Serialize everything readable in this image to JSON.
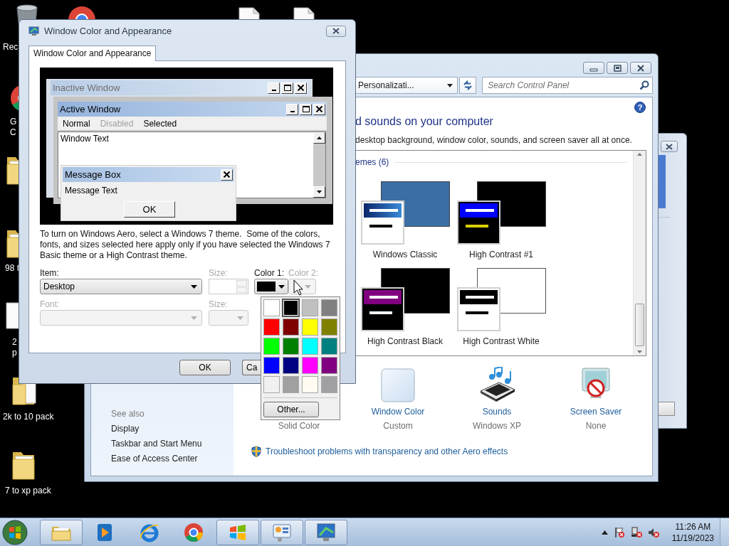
{
  "desktop": {
    "icons": [
      {
        "kind": "recycle-bin",
        "label_lines": [
          "Rec"
        ]
      },
      {
        "kind": "round-logo"
      },
      {
        "kind": "document"
      },
      {
        "kind": "document"
      },
      {
        "kind": "round-logo",
        "label_lines": [
          "G",
          "C"
        ]
      },
      {
        "kind": "folder"
      },
      {
        "kind": "folder",
        "label_lines": [
          "98 t"
        ]
      },
      {
        "kind": "document",
        "label_lines": [
          "2",
          "p"
        ]
      },
      {
        "kind": "folder-page",
        "label_lines": [
          "2k to 10 pack"
        ]
      },
      {
        "kind": "folder",
        "label_lines": [
          "7 to xp pack"
        ]
      }
    ]
  },
  "control_panel": {
    "address": "Personalizati...",
    "help_button": "?",
    "search": {
      "placeholder": "Search Control Panel"
    },
    "heading": "d sounds on your computer",
    "subtitle": "desktop background, window color, sounds, and screen saver all at once.",
    "themes_header": "emes (6)",
    "themes": [
      {
        "name": "Windows Classic",
        "kind": "classic"
      },
      {
        "name": "High Contrast #1",
        "kind": "contrast-1"
      },
      {
        "name": "High Contrast Black",
        "kind": "contrast-black"
      },
      {
        "name": "High Contrast White",
        "kind": "contrast-white"
      }
    ],
    "settings": [
      {
        "kind": "background",
        "value": "Solid Color"
      },
      {
        "kind": "window-color",
        "title": "Window Color",
        "value": "Custom"
      },
      {
        "kind": "sounds",
        "title": "Sounds",
        "value": "Windows XP"
      },
      {
        "kind": "screen-saver",
        "title": "Screen Saver",
        "value": "None"
      }
    ],
    "see_also": {
      "title": "See also",
      "links": [
        "Display",
        "Taskbar and Start Menu",
        "Ease of Access Center"
      ]
    },
    "troubleshoot_link": "Troubleshoot problems with transparency and other Aero effects"
  },
  "appearance_dialog": {
    "title": "Window Color and Appearance",
    "tabs": [
      {
        "label": "Window Color and Appearance",
        "selected": true
      }
    ],
    "preview": {
      "inactive_title": "Inactive Window",
      "active_title": "Active Window",
      "menu": [
        {
          "label": "Normal",
          "disabled": false
        },
        {
          "label": "Disabled",
          "disabled": true
        },
        {
          "label": "Selected",
          "disabled": false
        }
      ],
      "window_text": "Window Text",
      "message_title": "Message Box",
      "message_text": "Message Text",
      "message_button": "OK"
    },
    "note": "To turn on Windows Aero, select a Windows 7 theme.  Some of the colors, fonts, and sizes selected here apply only if you have selected the Windows 7 Basic theme or a High Contrast theme.",
    "item": {
      "label": "Item:",
      "value": "Desktop",
      "disabled": false
    },
    "size": {
      "label": "Size:",
      "disabled": true
    },
    "color_1": {
      "label": "Color 1:",
      "color": "#000000",
      "disabled": false
    },
    "color_2": {
      "label": "Color 2:",
      "disabled": true
    },
    "font": {
      "label": "Font:",
      "disabled": true
    },
    "font_size": {
      "label": "Size:",
      "disabled": true
    },
    "buttons": [
      "OK",
      "Ca"
    ]
  },
  "color_picker": {
    "swatches": [
      {
        "color": "#ffffff",
        "selected": false
      },
      {
        "color": "#000000",
        "selected": true
      },
      {
        "color": "#c0c0c0",
        "selected": false
      },
      {
        "color": "#808080",
        "selected": false
      },
      {
        "color": "#ff0000",
        "selected": false
      },
      {
        "color": "#800000",
        "selected": false
      },
      {
        "color": "#ffff00",
        "selected": false
      },
      {
        "color": "#808000",
        "selected": false
      },
      {
        "color": "#00ff00",
        "selected": false
      },
      {
        "color": "#008000",
        "selected": false
      },
      {
        "color": "#00ffff",
        "selected": false
      },
      {
        "color": "#008080",
        "selected": false
      },
      {
        "color": "#0000ff",
        "selected": false
      },
      {
        "color": "#000080",
        "selected": false
      },
      {
        "color": "#ff00ff",
        "selected": false
      },
      {
        "color": "#800080",
        "selected": false
      },
      {
        "color": "#f0f0f0",
        "selected": false
      },
      {
        "color": "#a0a0a0",
        "selected": false
      },
      {
        "color": "#fffbf0",
        "selected": false
      },
      {
        "color": "#a0a0a4",
        "selected": false
      }
    ],
    "other_button": "Other..."
  },
  "taskbar": {
    "apps": [
      {
        "kind": "folder",
        "open": true
      },
      {
        "kind": "media",
        "open": false
      },
      {
        "kind": "e-browser",
        "open": false
      },
      {
        "kind": "ring-browser",
        "open": false
      },
      {
        "kind": "flag-logo",
        "open": true
      },
      {
        "kind": "control-panel",
        "open": true
      },
      {
        "kind": "display",
        "open": true
      }
    ],
    "clock": {
      "time": "11:26 AM",
      "date": "11/19/2023"
    }
  }
}
